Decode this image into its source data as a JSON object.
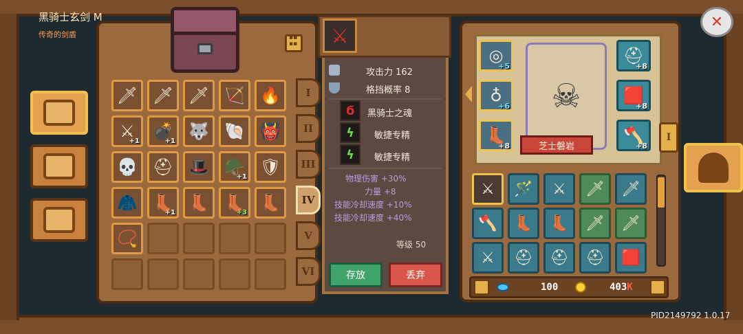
{
  "inventory": {
    "tiers": [
      "I",
      "II",
      "III",
      "IV",
      "V",
      "VI"
    ],
    "active_tier": "IV",
    "slots": [
      {
        "icon": "green-sword",
        "count": ""
      },
      {
        "icon": "golden-sword",
        "count": ""
      },
      {
        "icon": "golden-sword-2",
        "count": ""
      },
      {
        "icon": "bow",
        "count": ""
      },
      {
        "icon": "fire-staff",
        "count": ""
      },
      {
        "icon": "red-crossed-swords",
        "count": "+1"
      },
      {
        "icon": "cannon",
        "count": "+1"
      },
      {
        "icon": "wolf-helmet",
        "count": ""
      },
      {
        "icon": "red-shell-armor",
        "count": ""
      },
      {
        "icon": "purple-spiked-armor",
        "count": ""
      },
      {
        "icon": "skull-armor",
        "count": ""
      },
      {
        "icon": "steel-helmet",
        "count": ""
      },
      {
        "icon": "purple-hood",
        "count": ""
      },
      {
        "icon": "purple-helmet",
        "count": "+1"
      },
      {
        "icon": "bronze-helmet",
        "count": ""
      },
      {
        "icon": "green-cape",
        "count": ""
      },
      {
        "icon": "dark-boots",
        "count": "+1"
      },
      {
        "icon": "green-boots",
        "count": ""
      },
      {
        "icon": "purple-boots",
        "count": "+3"
      },
      {
        "icon": "skull-boots",
        "count": ""
      },
      {
        "icon": "gold-necklace",
        "count": ""
      }
    ]
  },
  "item": {
    "name": "黑骑士玄剑 M",
    "type": "传奇的剑盾",
    "attack": "攻击力 162",
    "block": "格挡概率 8",
    "perks": [
      "黑骑士之魂",
      "敏捷专精",
      "敏捷专精"
    ],
    "bonuses": [
      "物理伤害 +30%",
      "力量 +8",
      "技能冷却速度 +10%",
      "技能冷却速度 +40%"
    ],
    "level": "等级 50",
    "store_label": "存放",
    "drop_label": "丢弃"
  },
  "character": {
    "name": "芝士磐岩",
    "gear": [
      {
        "icon": "teal-ring",
        "level": "+5"
      },
      {
        "icon": "horned-ring",
        "level": "+6"
      },
      {
        "icon": "boots",
        "level": "+8"
      },
      {
        "icon": "knight-helmet",
        "level": "+8"
      },
      {
        "icon": "red-armor",
        "level": "+8"
      },
      {
        "icon": "axe",
        "level": "+8"
      }
    ],
    "backpack": [
      {
        "icon": "black-knight-sword"
      },
      {
        "icon": "purple-staff"
      },
      {
        "icon": "crossed-swords"
      },
      {
        "icon": "greatsword"
      },
      {
        "icon": "dagger"
      },
      {
        "icon": "battle-axe"
      },
      {
        "icon": "boots"
      },
      {
        "icon": "boots-2"
      },
      {
        "icon": "spear"
      },
      {
        "icon": "dagger-2"
      },
      {
        "icon": "crossed-blades"
      },
      {
        "icon": "red-helmet"
      },
      {
        "icon": "red-helmet-2"
      },
      {
        "icon": "red-helmet-3"
      },
      {
        "icon": "red-armor"
      }
    ]
  },
  "currency": {
    "gems": "100",
    "gold": "403",
    "gold_suffix": "K"
  },
  "version": "PID2149792 1.0.17"
}
